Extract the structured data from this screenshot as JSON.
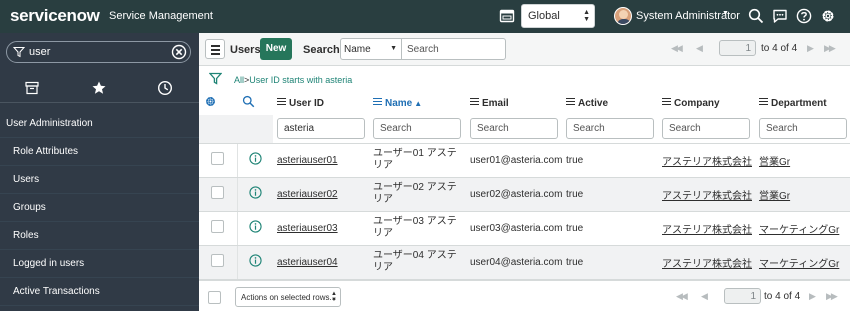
{
  "header": {
    "brand": "servicenow",
    "product": "Service Management",
    "scope": "Global",
    "user_name": "System Administrator",
    "icons": [
      "window-icon",
      "search-icon",
      "chat-icon",
      "help-icon",
      "gear-icon"
    ]
  },
  "sidebar": {
    "filter_value": "user",
    "tabs": [
      "all-apps-icon",
      "favorites-icon",
      "history-icon"
    ],
    "items": [
      {
        "label": "User Administration"
      },
      {
        "label": "Role Attributes"
      },
      {
        "label": "Users"
      },
      {
        "label": "Groups"
      },
      {
        "label": "Roles"
      },
      {
        "label": "Logged in users"
      },
      {
        "label": "Active Transactions"
      }
    ]
  },
  "toolbar": {
    "title": "Users",
    "new_label": "New",
    "search_label": "Search",
    "search_field": "Name",
    "search_placeholder": "Search",
    "page_value": "1",
    "page_text": "to 4 of 4"
  },
  "breadcrumb": {
    "all": "All",
    "separator": ">",
    "condition": "User ID starts with asteria"
  },
  "table": {
    "columns": [
      "User ID",
      "Name",
      "Email",
      "Active",
      "Company",
      "Department"
    ],
    "sort_column": "Name",
    "filters": {
      "user_id_value": "asteria",
      "placeholder": "Search"
    },
    "rows": [
      {
        "user_id": "asteriauser01",
        "name": "ユーザー01 アステリア",
        "email": "user01@asteria.com",
        "active": "true",
        "company": "アステリア株式会社",
        "department": "営業Gr"
      },
      {
        "user_id": "asteriauser02",
        "name": "ユーザー02 アステリア",
        "email": "user02@asteria.com",
        "active": "true",
        "company": "アステリア株式会社",
        "department": "営業Gr"
      },
      {
        "user_id": "asteriauser03",
        "name": "ユーザー03 アステリア",
        "email": "user03@asteria.com",
        "active": "true",
        "company": "アステリア株式会社",
        "department": "マーケティングGr"
      },
      {
        "user_id": "asteriauser04",
        "name": "ユーザー04 アステリア",
        "email": "user04@asteria.com",
        "active": "true",
        "company": "アステリア株式会社",
        "department": "マーケティングGr"
      }
    ]
  },
  "footer": {
    "actions_label": "Actions on selected rows...",
    "page_value": "1",
    "page_text": "to 4 of 4"
  },
  "colors": {
    "header_bg": "#293e40",
    "sidebar_bg": "#303a46",
    "new_button": "#26765b",
    "link_accent": "#1f6fb4",
    "breadcrumb": "#1f8476"
  }
}
